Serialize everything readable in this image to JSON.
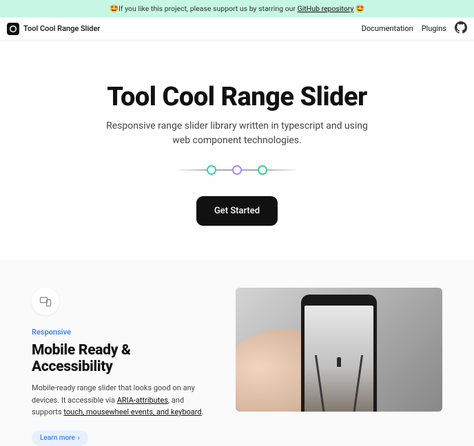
{
  "announcement": {
    "prefix": "🤩If you like this project, please support us by starring our ",
    "link_text": "GitHub repository",
    "suffix": " 🤩"
  },
  "nav": {
    "brand": "Tool Cool Range Slider",
    "links": {
      "docs": "Documentation",
      "plugins": "Plugins"
    }
  },
  "hero": {
    "title": "Tool Cool Range Slider",
    "subtitle": "Responsive range slider library written in typescript and using web component technologies.",
    "cta": "Get Started"
  },
  "feature": {
    "eyebrow": "Responsive",
    "heading": "Mobile Ready & Accessibility",
    "text_1": "Mobile-ready range slider that looks good on any devices. It accessible via ",
    "link_1": "ARIA-attributes",
    "text_2": ", and supports ",
    "link_2": "touch, mousewheel events, and keyboard",
    "text_3": ".",
    "learn_more": "Learn more"
  }
}
